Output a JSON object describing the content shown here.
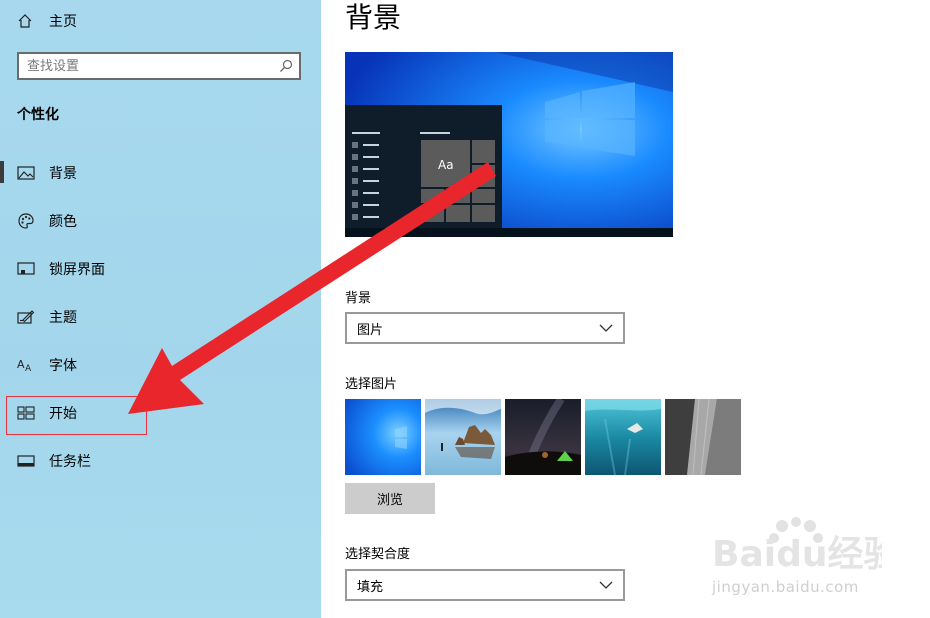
{
  "sidebar": {
    "home": {
      "label": "主页",
      "icon": "home-icon"
    },
    "search": {
      "placeholder": "查找设置",
      "icon": "search-icon"
    },
    "section_title": "个性化",
    "items": [
      {
        "label": "背景",
        "icon": "picture-icon",
        "selected": true
      },
      {
        "label": "颜色",
        "icon": "palette-icon"
      },
      {
        "label": "锁屏界面",
        "icon": "lock-screen-icon"
      },
      {
        "label": "主题",
        "icon": "theme-icon"
      },
      {
        "label": "字体",
        "icon": "font-icon"
      },
      {
        "label": "开始",
        "icon": "start-menu-icon",
        "highlighted": true
      },
      {
        "label": "任务栏",
        "icon": "taskbar-icon"
      }
    ]
  },
  "main": {
    "title": "背景",
    "preview": {
      "tile_text": "Aa"
    },
    "background": {
      "label": "背景",
      "value": "图片"
    },
    "choose_picture": {
      "label": "选择图片",
      "thumbnails": [
        "windows-default",
        "beach-rocks",
        "night-sky-tent",
        "underwater-swimmer",
        "rock-cliff"
      ]
    },
    "browse_button": "浏览",
    "fit": {
      "label": "选择契合度",
      "value": "填充"
    }
  },
  "watermark": {
    "logo_text": "Baidu经验",
    "url": "jingyan.baidu.com"
  },
  "colors": {
    "sidebar": "#a7d8ee",
    "highlight": "#e5323c",
    "arrow": "#e8262c",
    "preview_blue": "#0a63d8"
  }
}
